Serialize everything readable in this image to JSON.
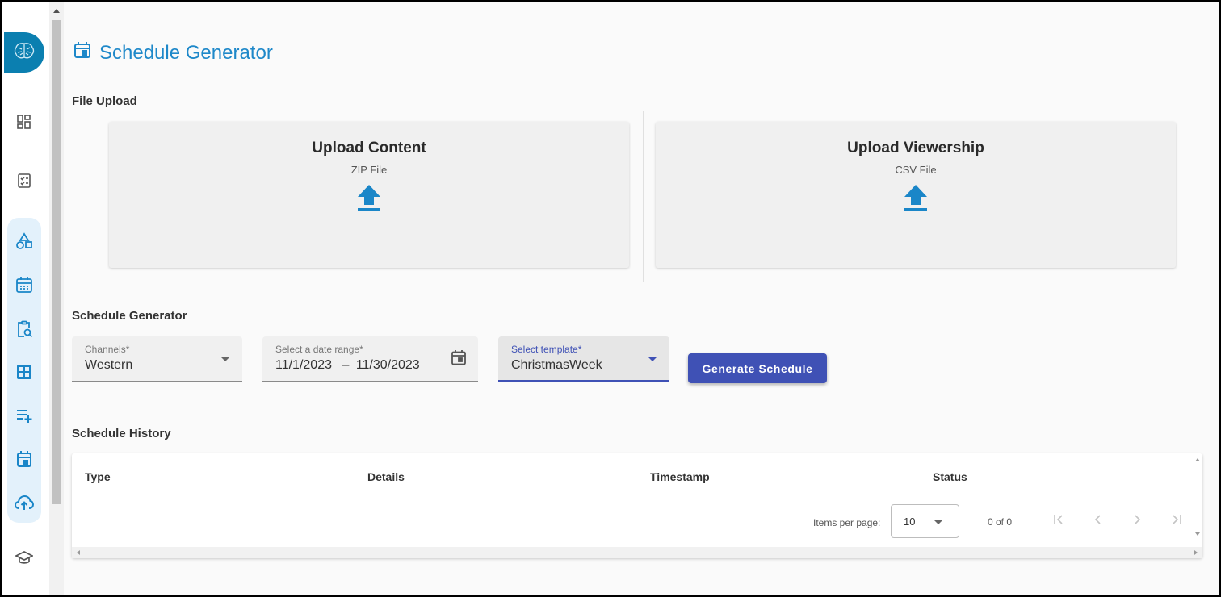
{
  "app": {
    "logo_icon": "brain-icon",
    "accent_color": "#1e88c9",
    "button_color": "#3f51b5"
  },
  "rail": {
    "items": [
      {
        "icon": "dashboard-icon"
      },
      {
        "icon": "checklist-icon"
      },
      {
        "icon": "shapes-icon"
      },
      {
        "icon": "calendar-grid-icon"
      },
      {
        "icon": "clipboard-search-icon"
      },
      {
        "icon": "grid-view-icon"
      },
      {
        "icon": "playlist-add-icon"
      },
      {
        "icon": "event-icon"
      },
      {
        "icon": "cloud-upload-icon"
      },
      {
        "icon": "school-icon"
      }
    ]
  },
  "page": {
    "title": "Schedule Generator",
    "title_icon": "event-icon"
  },
  "file_upload": {
    "section_label": "File Upload",
    "content": {
      "title": "Upload Content",
      "subtitle": "ZIP File"
    },
    "viewership": {
      "title": "Upload Viewership",
      "subtitle": "CSV File"
    }
  },
  "generator": {
    "section_label": "Schedule Generator",
    "channels": {
      "label": "Channels*",
      "value": "Western"
    },
    "date_range": {
      "label": "Select a date range*",
      "start": "11/1/2023",
      "separator": "–",
      "end": "11/30/2023"
    },
    "template": {
      "label": "Select template*",
      "value": "ChristmasWeek"
    },
    "generate_label": "Generate Schedule"
  },
  "history": {
    "section_label": "Schedule History",
    "columns": [
      "Type",
      "Details",
      "Timestamp",
      "Status"
    ],
    "rows": [],
    "paginator": {
      "items_per_page_label": "Items per page:",
      "page_size": "10",
      "range_label": "0 of 0"
    }
  }
}
